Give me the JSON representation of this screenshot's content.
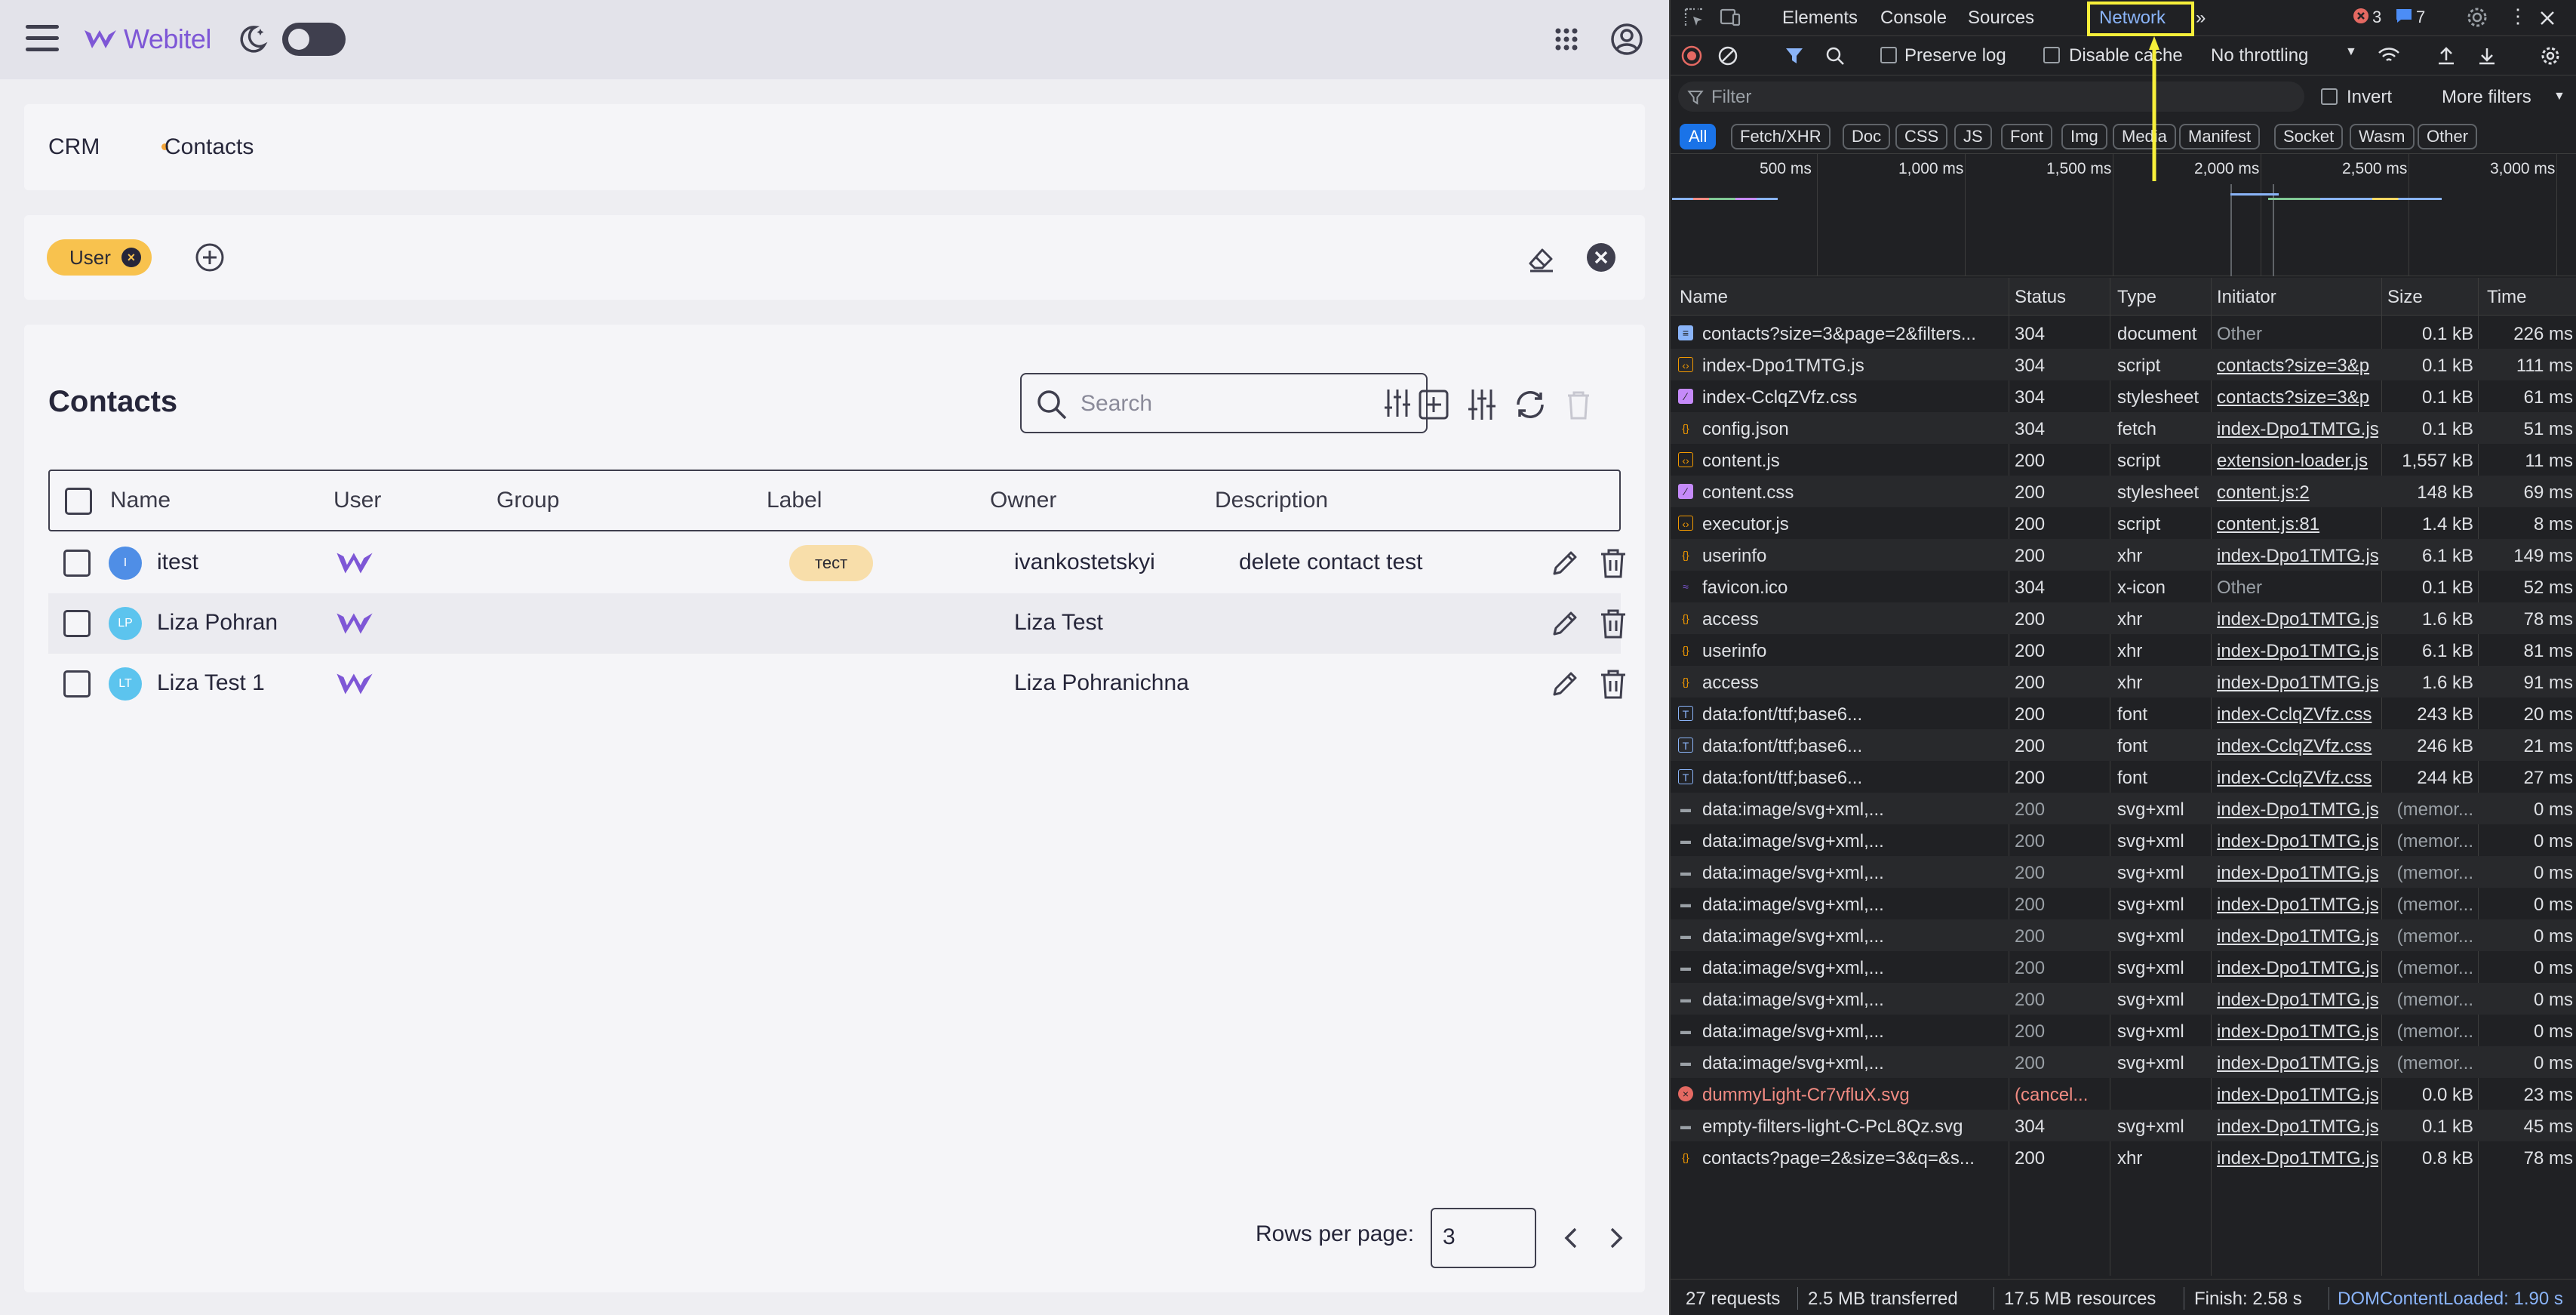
{
  "app": {
    "logo_text": "Webitel",
    "brand_color": "#7e57d6",
    "breadcrumb": [
      "CRM",
      "Contacts"
    ],
    "filters": {
      "chip_label": "User"
    },
    "title": "Contacts",
    "search_placeholder": "Search",
    "columns": [
      "Name",
      "User",
      "Group",
      "Label",
      "Owner",
      "Description"
    ],
    "rows": [
      {
        "initials": "I",
        "avatar_color": "#4f8ee6",
        "name": "itest",
        "label": "тест",
        "owner": "ivankostetskyi",
        "description": "delete contact test"
      },
      {
        "initials": "LP",
        "avatar_color": "#5cc4ee",
        "name": "Liza Pohran",
        "label": "",
        "owner": "Liza Test",
        "description": ""
      },
      {
        "initials": "LT",
        "avatar_color": "#5cc4ee",
        "name": "Liza Test 1",
        "label": "",
        "owner": "Liza Pohranichna",
        "description": ""
      }
    ],
    "rows_per_page_label": "Rows per page:",
    "rows_per_page_value": "3"
  },
  "devtools": {
    "tabs": [
      "Elements",
      "Console",
      "Sources",
      "Network"
    ],
    "active_tab": "Network",
    "error_count": "3",
    "message_count": "7",
    "toolbar": {
      "preserve_log": "Preserve log",
      "disable_cache": "Disable cache",
      "throttling": "No throttling"
    },
    "filter": {
      "placeholder": "Filter",
      "invert": "Invert",
      "more_filters": "More filters"
    },
    "types": [
      "All",
      "Fetch/XHR",
      "Doc",
      "CSS",
      "JS",
      "Font",
      "Img",
      "Media",
      "Manifest",
      "Socket",
      "Wasm",
      "Other"
    ],
    "timeline_labels": [
      "500 ms",
      "1,000 ms",
      "1,500 ms",
      "2,000 ms",
      "2,500 ms",
      "3,000 ms"
    ],
    "columns": [
      "Name",
      "Status",
      "Type",
      "Initiator",
      "Size",
      "Time"
    ],
    "requests": [
      {
        "icon": "doc",
        "name": "contacts?size=3&page=2&filters...",
        "status": "304",
        "type": "document",
        "initiator": "Other",
        "size": "0.1 kB",
        "time": "226 ms"
      },
      {
        "icon": "js",
        "name": "index-Dpo1TMTG.js",
        "status": "304",
        "type": "script",
        "initiator": "contacts?size=3&p",
        "size": "0.1 kB",
        "time": "111 ms"
      },
      {
        "icon": "css",
        "name": "index-CclqZVfz.css",
        "status": "304",
        "type": "stylesheet",
        "initiator": "contacts?size=3&p",
        "size": "0.1 kB",
        "time": "61 ms"
      },
      {
        "icon": "xhr",
        "name": "config.json",
        "status": "304",
        "type": "fetch",
        "initiator": "index-Dpo1TMTG.js",
        "size": "0.1 kB",
        "time": "51 ms"
      },
      {
        "icon": "js",
        "name": "content.js",
        "status": "200",
        "type": "script",
        "initiator": "extension-loader.js",
        "size": "1,557 kB",
        "time": "11 ms"
      },
      {
        "icon": "css",
        "name": "content.css",
        "status": "200",
        "type": "stylesheet",
        "initiator": "content.js:2",
        "size": "148 kB",
        "time": "69 ms"
      },
      {
        "icon": "js",
        "name": "executor.js",
        "status": "200",
        "type": "script",
        "initiator": "content.js:81",
        "size": "1.4 kB",
        "time": "8 ms"
      },
      {
        "icon": "xhr",
        "name": "userinfo",
        "status": "200",
        "type": "xhr",
        "initiator": "index-Dpo1TMTG.js",
        "size": "6.1 kB",
        "time": "149 ms"
      },
      {
        "icon": "img",
        "name": "favicon.ico",
        "status": "304",
        "type": "x-icon",
        "initiator": "Other",
        "size": "0.1 kB",
        "time": "52 ms"
      },
      {
        "icon": "xhr",
        "name": "access",
        "status": "200",
        "type": "xhr",
        "initiator": "index-Dpo1TMTG.js",
        "size": "1.6 kB",
        "time": "78 ms"
      },
      {
        "icon": "xhr",
        "name": "userinfo",
        "status": "200",
        "type": "xhr",
        "initiator": "index-Dpo1TMTG.js",
        "size": "6.1 kB",
        "time": "81 ms"
      },
      {
        "icon": "xhr",
        "name": "access",
        "status": "200",
        "type": "xhr",
        "initiator": "index-Dpo1TMTG.js",
        "size": "1.6 kB",
        "time": "91 ms"
      },
      {
        "icon": "font",
        "name": "data:font/ttf;base6...",
        "status": "200",
        "type": "font",
        "initiator": "index-CclqZVfz.css",
        "size": "243 kB",
        "time": "20 ms"
      },
      {
        "icon": "font",
        "name": "data:font/ttf;base6...",
        "status": "200",
        "type": "font",
        "initiator": "index-CclqZVfz.css",
        "size": "246 kB",
        "time": "21 ms"
      },
      {
        "icon": "font",
        "name": "data:font/ttf;base6...",
        "status": "200",
        "type": "font",
        "initiator": "index-CclqZVfz.css",
        "size": "244 kB",
        "time": "27 ms"
      },
      {
        "icon": "svg",
        "name": "data:image/svg+xml,...",
        "status": "200",
        "type": "svg+xml",
        "initiator": "index-Dpo1TMTG.js",
        "size": "(memor...",
        "time": "0 ms"
      },
      {
        "icon": "svg",
        "name": "data:image/svg+xml,...",
        "status": "200",
        "type": "svg+xml",
        "initiator": "index-Dpo1TMTG.js",
        "size": "(memor...",
        "time": "0 ms"
      },
      {
        "icon": "svg",
        "name": "data:image/svg+xml,...",
        "status": "200",
        "type": "svg+xml",
        "initiator": "index-Dpo1TMTG.js",
        "size": "(memor...",
        "time": "0 ms"
      },
      {
        "icon": "svg",
        "name": "data:image/svg+xml,...",
        "status": "200",
        "type": "svg+xml",
        "initiator": "index-Dpo1TMTG.js",
        "size": "(memor...",
        "time": "0 ms"
      },
      {
        "icon": "svg",
        "name": "data:image/svg+xml,...",
        "status": "200",
        "type": "svg+xml",
        "initiator": "index-Dpo1TMTG.js",
        "size": "(memor...",
        "time": "0 ms"
      },
      {
        "icon": "svg",
        "name": "data:image/svg+xml,...",
        "status": "200",
        "type": "svg+xml",
        "initiator": "index-Dpo1TMTG.js",
        "size": "(memor...",
        "time": "0 ms"
      },
      {
        "icon": "svg",
        "name": "data:image/svg+xml,...",
        "status": "200",
        "type": "svg+xml",
        "initiator": "index-Dpo1TMTG.js",
        "size": "(memor...",
        "time": "0 ms"
      },
      {
        "icon": "svg",
        "name": "data:image/svg+xml,...",
        "status": "200",
        "type": "svg+xml",
        "initiator": "index-Dpo1TMTG.js",
        "size": "(memor...",
        "time": "0 ms"
      },
      {
        "icon": "svg",
        "name": "data:image/svg+xml,...",
        "status": "200",
        "type": "svg+xml",
        "initiator": "index-Dpo1TMTG.js",
        "size": "(memor...",
        "time": "0 ms"
      },
      {
        "icon": "err",
        "name": "dummyLight-Cr7vfluX.svg",
        "status": "(cancel...",
        "type": "",
        "initiator": "index-Dpo1TMTG.js",
        "size": "0.0 kB",
        "time": "23 ms"
      },
      {
        "icon": "svg",
        "name": "empty-filters-light-C-PcL8Qz.svg",
        "status": "304",
        "type": "svg+xml",
        "initiator": "index-Dpo1TMTG.js",
        "size": "0.1 kB",
        "time": "45 ms"
      },
      {
        "icon": "xhr",
        "name": "contacts?page=2&size=3&q=&s...",
        "status": "200",
        "type": "xhr",
        "initiator": "index-Dpo1TMTG.js",
        "size": "0.8 kB",
        "time": "78 ms"
      }
    ],
    "status_bar": {
      "requests": "27 requests",
      "transferred": "2.5 MB transferred",
      "resources": "17.5 MB resources",
      "finish": "Finish: 2.58 s",
      "dcl": "DOMContentLoaded: 1.90 s"
    }
  }
}
